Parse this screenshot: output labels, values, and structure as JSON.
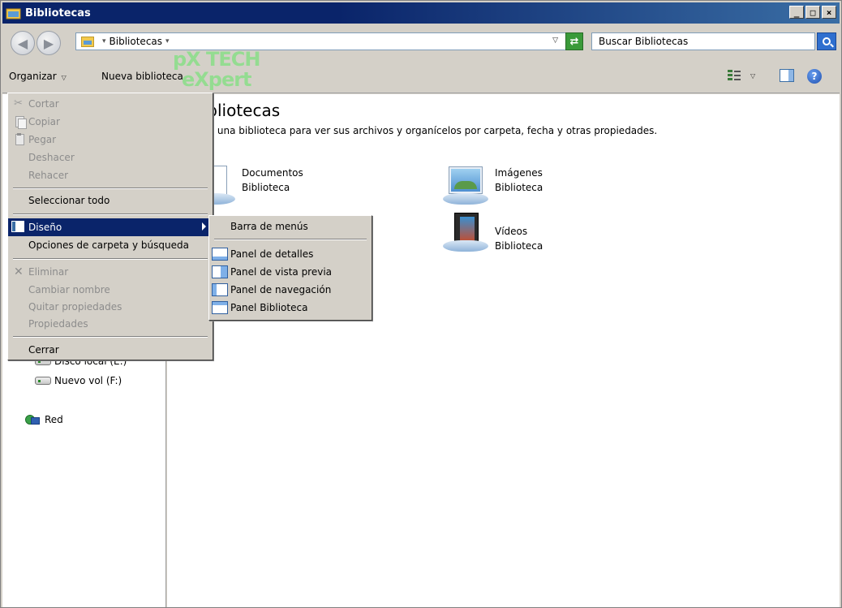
{
  "window": {
    "title": "Bibliotecas",
    "controls": {
      "minimize": "_",
      "maximize": "□",
      "close": "×"
    }
  },
  "address": {
    "crumb": "Bibliotecas",
    "search_placeholder": "Buscar Bibliotecas"
  },
  "toolbar": {
    "organize_label": "Organizar",
    "new_library_label": "Nueva biblioteca"
  },
  "watermark": {
    "line1": "pX TECH",
    "line2": "eXpert"
  },
  "content": {
    "title": "Bibliotecas",
    "description": "Abra una biblioteca para ver sus archivos y organícelos por carpeta, fecha y otras propiedades.",
    "libraries": [
      {
        "name": "Documentos",
        "type": "Biblioteca",
        "icon": "documents-library-icon"
      },
      {
        "name": "Imágenes",
        "type": "Biblioteca",
        "icon": "pictures-library-icon"
      },
      {
        "name": "Vídeos",
        "type": "Biblioteca",
        "icon": "videos-library-icon"
      }
    ]
  },
  "nav": {
    "drives": [
      {
        "label": "Disco local (E:)"
      },
      {
        "label": "Nuevo vol (F:)"
      }
    ],
    "network": {
      "label": "Red"
    }
  },
  "organize_menu": {
    "items": [
      {
        "label": "Cortar",
        "enabled": false
      },
      {
        "label": "Copiar",
        "enabled": false
      },
      {
        "label": "Pegar",
        "enabled": false
      },
      {
        "label": "Deshacer",
        "enabled": false
      },
      {
        "label": "Rehacer",
        "enabled": false
      },
      {
        "label": "Seleccionar todo",
        "enabled": true
      },
      {
        "label": "Diseño",
        "enabled": true,
        "selected": true
      },
      {
        "label": "Opciones de carpeta y búsqueda",
        "enabled": true
      },
      {
        "label": "Eliminar",
        "enabled": false
      },
      {
        "label": "Cambiar nombre",
        "enabled": false
      },
      {
        "label": "Quitar propiedades",
        "enabled": false
      },
      {
        "label": "Propiedades",
        "enabled": false
      },
      {
        "label": "Cerrar",
        "enabled": true
      }
    ]
  },
  "layout_submenu": {
    "items": [
      {
        "label": "Barra de menús"
      },
      {
        "label": "Panel de detalles"
      },
      {
        "label": "Panel de vista previa"
      },
      {
        "label": "Panel de navegación"
      },
      {
        "label": "Panel Biblioteca"
      }
    ]
  },
  "colors": {
    "selection": "#0a246a",
    "titlebar": "#0a246a",
    "disabled_text": "#8c8c8c"
  }
}
